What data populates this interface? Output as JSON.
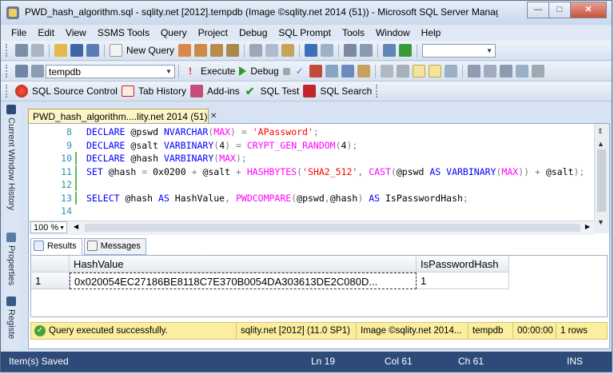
{
  "window": {
    "title": "PWD_hash_algorithm.sql - sqlity.net [2012].tempdb (Image ©sqlity.net 2014 (51)) - Microsoft SQL Server Manageme...",
    "minimize": "—",
    "maximize": "□",
    "close": "✕"
  },
  "menu": [
    "File",
    "Edit",
    "View",
    "SSMS Tools",
    "Query",
    "Project",
    "Debug",
    "SQL Prompt",
    "Tools",
    "Window",
    "Help"
  ],
  "toolbar1": {
    "new_query": "New Query"
  },
  "toolbar2": {
    "database": "tempdb",
    "execute": "Execute",
    "debug": "Debug"
  },
  "toolbar3": {
    "source_control": "SQL Source Control",
    "tab_history": "Tab History",
    "addins": "Add-ins",
    "sql_test": "SQL Test",
    "sql_search": "SQL Search"
  },
  "sidebar": {
    "current_window_history": "Current Window History",
    "properties": "Properties",
    "registered": "Registe"
  },
  "document": {
    "tab_title": "PWD_hash_algorithm....lity.net 2014 (51))",
    "tab_close": "✕",
    "zoom": "100 %"
  },
  "code": [
    {
      "n": "8",
      "changed": false,
      "parts": [
        [
          "kw",
          "DECLARE "
        ],
        [
          "var",
          "@pswd "
        ],
        [
          "kw",
          "NVARCHAR"
        ],
        [
          "gr",
          "("
        ],
        [
          "fn",
          "MAX"
        ],
        [
          "gr",
          ") = "
        ],
        [
          "str",
          "'APassword'"
        ],
        [
          "gr",
          ";"
        ]
      ]
    },
    {
      "n": "9",
      "changed": false,
      "parts": [
        [
          "kw",
          "DECLARE "
        ],
        [
          "var",
          "@salt "
        ],
        [
          "kw",
          "VARBINARY"
        ],
        [
          "gr",
          "("
        ],
        [
          "var",
          "4"
        ],
        [
          "gr",
          ") = "
        ],
        [
          "fn",
          "CRYPT_GEN_RANDOM"
        ],
        [
          "gr",
          "("
        ],
        [
          "var",
          "4"
        ],
        [
          "gr",
          ");"
        ]
      ]
    },
    {
      "n": "10",
      "changed": true,
      "parts": [
        [
          "kw",
          "DECLARE "
        ],
        [
          "var",
          "@hash "
        ],
        [
          "kw",
          "VARBINARY"
        ],
        [
          "gr",
          "("
        ],
        [
          "fn",
          "MAX"
        ],
        [
          "gr",
          ");"
        ]
      ]
    },
    {
      "n": "11",
      "changed": true,
      "parts": [
        [
          "kw",
          "SET "
        ],
        [
          "var",
          "@hash "
        ],
        [
          "gr",
          "= "
        ],
        [
          "var",
          "0x0200 "
        ],
        [
          "gr",
          "+ "
        ],
        [
          "var",
          "@salt "
        ],
        [
          "gr",
          "+ "
        ],
        [
          "fn",
          "HASHBYTES"
        ],
        [
          "gr",
          "("
        ],
        [
          "str",
          "'SHA2_512'"
        ],
        [
          "gr",
          ", "
        ],
        [
          "fn",
          "CAST"
        ],
        [
          "gr",
          "("
        ],
        [
          "var",
          "@pswd "
        ],
        [
          "kw",
          "AS VARBINARY"
        ],
        [
          "gr",
          "("
        ],
        [
          "fn",
          "MAX"
        ],
        [
          "gr",
          ")) + "
        ],
        [
          "var",
          "@salt"
        ],
        [
          "gr",
          ");"
        ]
      ]
    },
    {
      "n": "12",
      "changed": true,
      "parts": []
    },
    {
      "n": "13",
      "changed": true,
      "parts": [
        [
          "kw",
          "SELECT "
        ],
        [
          "var",
          "@hash "
        ],
        [
          "kw",
          "AS "
        ],
        [
          "var",
          "HashValue"
        ],
        [
          "gr",
          ", "
        ],
        [
          "fn",
          "PWDCOMPARE"
        ],
        [
          "gr",
          "("
        ],
        [
          "var",
          "@pswd"
        ],
        [
          "gr",
          ","
        ],
        [
          "var",
          "@hash"
        ],
        [
          "gr",
          ") "
        ],
        [
          "kw",
          "AS "
        ],
        [
          "var",
          "IsPasswordHash"
        ],
        [
          "gr",
          ";"
        ]
      ]
    },
    {
      "n": "14",
      "changed": false,
      "parts": []
    }
  ],
  "results": {
    "tabs": [
      "Results",
      "Messages"
    ],
    "columns": [
      "HashValue",
      "IsPasswordHash"
    ],
    "rows": [
      [
        "1",
        "0x020054EC27186BE8118C7E370B0054DA303613DE2C080D...",
        "1"
      ]
    ]
  },
  "query_status": {
    "message": "Query executed successfully.",
    "server": "sqlity.net [2012] (11.0 SP1)",
    "login": "Image ©sqlity.net 2014...",
    "database": "tempdb",
    "elapsed": "00:00:00",
    "rows": "1 rows"
  },
  "statusbar": {
    "left": "Item(s) Saved",
    "ln": "Ln 19",
    "col": "Col 61",
    "ch": "Ch 61",
    "mode": "INS"
  },
  "colors": {
    "statusbar_bg": "#2d4a78",
    "query_status_bg": "#fbee9e",
    "doc_tab_bg": "#fdf5c8"
  }
}
